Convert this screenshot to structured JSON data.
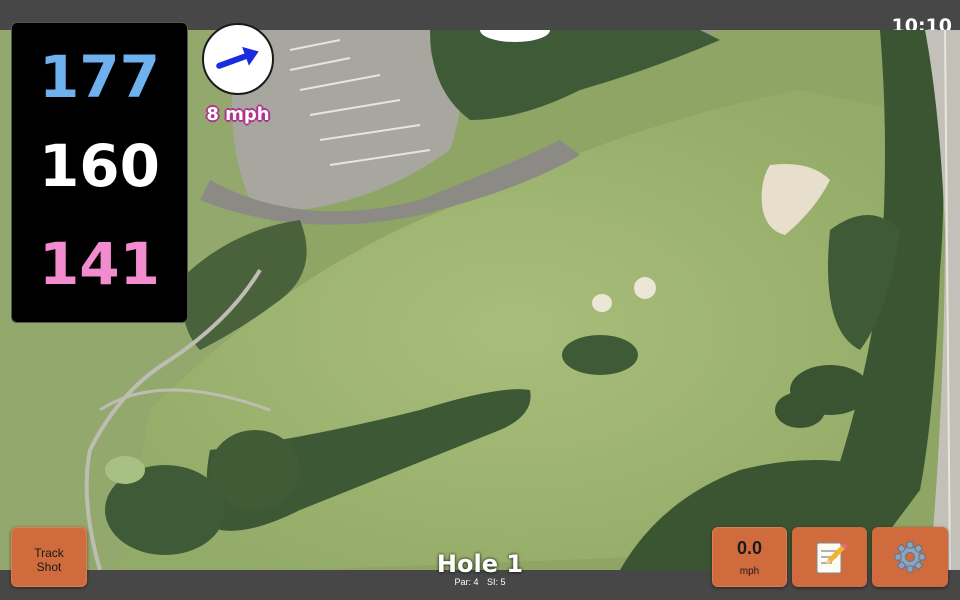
{
  "status_bar": {
    "time": "10:10"
  },
  "distances": {
    "back": {
      "value": "177",
      "color": "#6fb1ef"
    },
    "middle": {
      "value": "160",
      "color": "#ffffff"
    },
    "front": {
      "value": "141",
      "color": "#f28ccf"
    }
  },
  "wind": {
    "icon": "wind-direction-arrow-icon",
    "speed": "8 mph",
    "arrow_color": "#1a2be0"
  },
  "buttons": {
    "track_shot": {
      "line1": "Track",
      "line2": "Shot"
    },
    "speed": {
      "value": "0.0",
      "unit": "mph"
    },
    "notes": {
      "icon": "memo-icon"
    },
    "settings": {
      "icon": "gear-icon"
    }
  },
  "hole": {
    "title": "Hole 1",
    "par": "Par: 4",
    "stroke_index": "SI: 5"
  },
  "map": {
    "type": "satellite-golf-hole",
    "fairway_color": "#9bb26e"
  }
}
